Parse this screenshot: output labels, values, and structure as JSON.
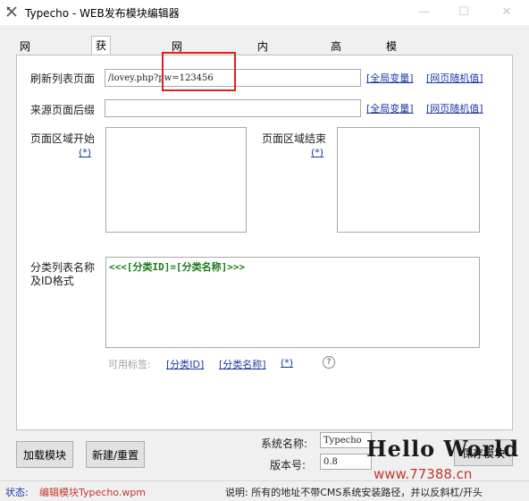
{
  "window": {
    "title": "Typecho - WEB发布模块编辑器",
    "minimize": "—",
    "maximize": "☐",
    "close": "✕"
  },
  "tabs": [
    {
      "label": "网站自动登录"
    },
    {
      "label": "获取栏目列表",
      "active": true
    },
    {
      "label": "网页随机值获取"
    },
    {
      "label": "内容发布参数"
    },
    {
      "label": "高级功能"
    },
    {
      "label": "模块说明/保护"
    }
  ],
  "form": {
    "refresh_label": "刷新列表页面",
    "refresh_value": "/lovey.php?pw=123456",
    "global_var_link": "[全局变量]",
    "random_link": "[网页随机值]",
    "referer_label": "来源页面后缀",
    "referer_value": "",
    "region_start_label": "页面区域开始",
    "region_start_star": "(*)",
    "region_end_label": "页面区域结束",
    "region_end_star": "(*)",
    "category_label_1": "分类列表名称",
    "category_label_2": "及ID格式",
    "category_value": "<<<[分类ID]=[分类名称]>>>",
    "available_tags_label": "可用标签:",
    "tag_category_id": "[分类ID]",
    "tag_category_name": "[分类名称]",
    "tag_star": "(*)",
    "help": "?"
  },
  "bottom": {
    "load_button": "加载模块",
    "new_button": "新建/重置",
    "system_name_label": "系统名称:",
    "system_name_value": "Typecho",
    "version_label": "版本号:",
    "version_value": "0.8",
    "save_button": "保存模块"
  },
  "status": {
    "prefix": "状态:",
    "text": "编辑模块Typecho.wpm",
    "note": "说明: 所有的地址不带CMS系统安装路径，并以反斜杠/开头"
  },
  "watermark": {
    "title": "Hello World",
    "url": "www.77388.cn"
  },
  "colors": {
    "link": "#1a3aa8",
    "highlight": "#e02020",
    "category_text": "#1a7a1a"
  }
}
